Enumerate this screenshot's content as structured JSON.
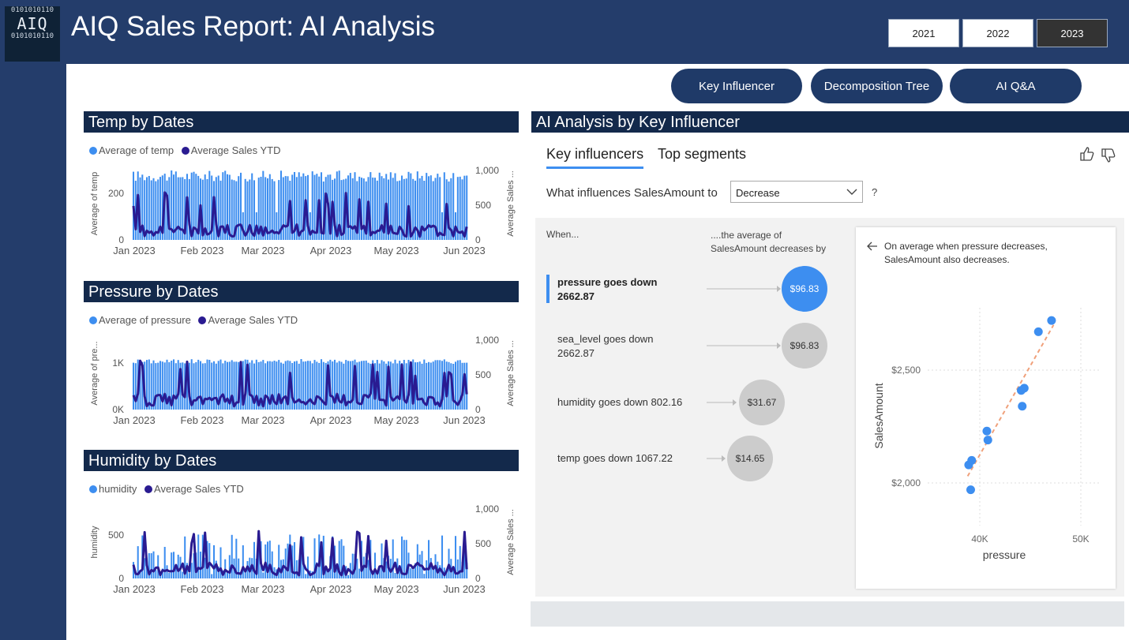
{
  "header": {
    "logo_text": "AIQ",
    "logo_bits": "0101010110",
    "title": "AIQ Sales Report: AI Analysis",
    "years": [
      "2021",
      "2022",
      "2023"
    ],
    "selected_year": "2023"
  },
  "nav": {
    "key_influencer": "Key Influencer",
    "decomposition_tree": "Decomposition Tree",
    "ai_qa": "AI Q&A"
  },
  "colors": {
    "sidebar": "#243d6b",
    "header_bar": "#13294b",
    "pill": "#1f3a68",
    "bar_series": "#3d8ef0",
    "line_series": "#2a1b91",
    "bubble_selected": "#3d8ef0",
    "bubble": "#cccccc"
  },
  "charts": {
    "temp": {
      "title": "Temp by Dates",
      "legend": [
        "Average of temp",
        "Average Sales YTD"
      ],
      "ylabel_left": "Average of temp",
      "ylabel_right": "Average Sales ...",
      "yticks_left": [
        "0",
        "200"
      ],
      "yticks_right": [
        "0",
        "500",
        "1,000"
      ],
      "xticks": [
        "Jan 2023",
        "Feb 2023",
        "Mar 2023",
        "Apr 2023",
        "May 2023",
        "Jun 2023"
      ]
    },
    "pressure": {
      "title": "Pressure by Dates",
      "legend": [
        "Average of pressure",
        "Average Sales YTD"
      ],
      "ylabel_left": "Average of pre...",
      "ylabel_right": "Average Sales ...",
      "yticks_left": [
        "0K",
        "1K"
      ],
      "yticks_right": [
        "0",
        "500",
        "1,000"
      ],
      "xticks": [
        "Jan 2023",
        "Feb 2023",
        "Mar 2023",
        "Apr 2023",
        "May 2023",
        "Jun 2023"
      ]
    },
    "humidity": {
      "title": "Humidity by Dates",
      "legend": [
        "humidity",
        "Average Sales YTD"
      ],
      "ylabel_left": "humidity",
      "ylabel_right": "Average Sales ...",
      "yticks_left": [
        "0",
        "500"
      ],
      "yticks_right": [
        "0",
        "500",
        "1,000"
      ],
      "xticks": [
        "Jan 2023",
        "Feb 2023",
        "Mar 2023",
        "Apr 2023",
        "May 2023",
        "Jun 2023"
      ]
    }
  },
  "ki": {
    "title": "AI Analysis by Key Influencer",
    "tab_active": "Key influencers",
    "tab_other": "Top segments",
    "question": "What influences SalesAmount to",
    "dropdown_value": "Decrease",
    "help": "?",
    "col_when": "When...",
    "col_effect_1": "....the average of",
    "col_effect_2": "SalesAmount decreases by",
    "rows": [
      {
        "l1": "pressure goes down",
        "l2": "2662.87",
        "value": "$96.83",
        "selected": true
      },
      {
        "l1": "sea_level goes down",
        "l2": "2662.87",
        "value": "$96.83",
        "selected": false
      },
      {
        "l1": "humidity goes down 802.16",
        "l2": "",
        "value": "$31.67",
        "selected": false
      },
      {
        "l1": "temp goes down 1067.22",
        "l2": "",
        "value": "$14.65",
        "selected": false
      }
    ],
    "detail_line1": "On average when pressure decreases,",
    "detail_line2": "SalesAmount also decreases."
  },
  "chart_data": {
    "type": "scatter",
    "title": "",
    "xlabel": "pressure",
    "ylabel": "SalesAmount",
    "xticks": [
      "40K",
      "50K"
    ],
    "yticks": [
      "$2,000",
      "$2,500"
    ],
    "xlim": [
      37500,
      51500
    ],
    "ylim": [
      1700,
      2950
    ],
    "points": [
      {
        "x": 38900,
        "y": 2080
      },
      {
        "x": 39200,
        "y": 2100
      },
      {
        "x": 39100,
        "y": 1970
      },
      {
        "x": 40700,
        "y": 2230
      },
      {
        "x": 40800,
        "y": 2190
      },
      {
        "x": 44100,
        "y": 2410
      },
      {
        "x": 44400,
        "y": 2420
      },
      {
        "x": 44200,
        "y": 2340
      },
      {
        "x": 45800,
        "y": 2670
      },
      {
        "x": 47100,
        "y": 2720
      }
    ],
    "trend": [
      [
        38800,
        2030
      ],
      [
        47300,
        2700
      ]
    ],
    "grid": true,
    "legend": "none"
  }
}
